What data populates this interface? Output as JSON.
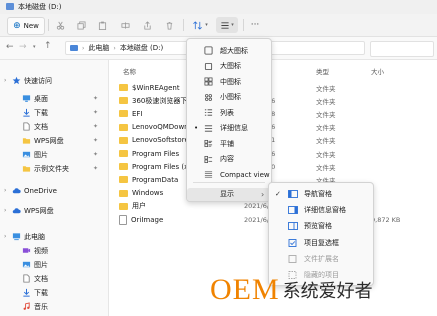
{
  "window": {
    "title": "本地磁盘 (D:)"
  },
  "toolbar": {
    "new_label": "New"
  },
  "address": {
    "path": [
      "此电脑",
      "本地磁盘 (D:)"
    ]
  },
  "nav": {
    "items": [
      {
        "label": "快速访问",
        "pinned": false,
        "icon": "star-icon",
        "color": "#2b6fd6"
      },
      {
        "label": "桌面",
        "pinned": true,
        "icon": "desktop-icon",
        "color": "#3a8fe0"
      },
      {
        "label": "下载",
        "pinned": true,
        "icon": "download-icon",
        "color": "#2b6fd6"
      },
      {
        "label": "文档",
        "pinned": true,
        "icon": "document-icon",
        "color": "#7a7a7a"
      },
      {
        "label": "WPS网盘",
        "pinned": true,
        "icon": "folder-icon",
        "color": "#f5c542"
      },
      {
        "label": "图片",
        "pinned": true,
        "icon": "picture-icon",
        "color": "#3a8fe0"
      },
      {
        "label": "示例文件夹",
        "pinned": true,
        "icon": "folder-icon",
        "color": "#f5c542"
      },
      {
        "label": "OneDrive",
        "pinned": false,
        "icon": "cloud-icon",
        "color": "#2b6fd6"
      },
      {
        "label": "WPS网盘",
        "pinned": false,
        "icon": "cloud-icon",
        "color": "#2b6fd6"
      },
      {
        "label": "此电脑",
        "pinned": false,
        "icon": "computer-icon",
        "color": "#3a8fe0"
      },
      {
        "label": "视频",
        "pinned": false,
        "icon": "video-icon",
        "color": "#8a4fd8"
      },
      {
        "label": "图片",
        "pinned": false,
        "icon": "picture-icon",
        "color": "#3a8fe0"
      },
      {
        "label": "文档",
        "pinned": false,
        "icon": "document-icon",
        "color": "#7a7a7a"
      },
      {
        "label": "下载",
        "pinned": false,
        "icon": "download-icon",
        "color": "#2b6fd6"
      },
      {
        "label": "音乐",
        "pinned": false,
        "icon": "music-icon",
        "color": "#e04a3a"
      }
    ]
  },
  "files": {
    "headers": {
      "name": "名称",
      "type": "类型",
      "size": "大小"
    },
    "rows": [
      {
        "name": "$WinREAgent",
        "date": "2:15",
        "type": "文件夹",
        "size": ""
      },
      {
        "name": "360极速浏览器下载",
        "date": "5/3 17:26",
        "type": "文件夹",
        "size": ""
      },
      {
        "name": "EFI",
        "date": "5/6 17:18",
        "type": "文件夹",
        "size": ""
      },
      {
        "name": "LenovoQMDownload",
        "date": "5/3 12:06",
        "type": "文件夹",
        "size": ""
      },
      {
        "name": "LenovoSoftstore",
        "date": "5/3 23:31",
        "type": "文件夹",
        "size": ""
      },
      {
        "name": "Program Files",
        "date": "5/6 17:26",
        "type": "文件夹",
        "size": ""
      },
      {
        "name": "Program Files (x86)",
        "date": "5/6 15:00",
        "type": "文件夹",
        "size": ""
      },
      {
        "name": "ProgramData",
        "date": "",
        "type": "文件夹",
        "size": ""
      },
      {
        "name": "Windows",
        "date": "2021/4/",
        "type": "文件夹",
        "size": ""
      },
      {
        "name": "用户",
        "date": "2021/6/",
        "type": "文件夹",
        "size": ""
      },
      {
        "name": "OriImage",
        "date": "2021/6/2",
        "type": "文件",
        "size": "9,872 KB"
      }
    ]
  },
  "view_menu": {
    "items": [
      {
        "label": "超大图标",
        "icon": "extra-large-icons-icon"
      },
      {
        "label": "大图标",
        "icon": "large-icons-icon"
      },
      {
        "label": "中图标",
        "icon": "medium-icons-icon"
      },
      {
        "label": "小图标",
        "icon": "small-icons-icon"
      },
      {
        "label": "列表",
        "icon": "list-view-icon"
      },
      {
        "label": "详细信息",
        "icon": "details-view-icon",
        "bullet": "•"
      },
      {
        "label": "平铺",
        "icon": "tiles-view-icon"
      },
      {
        "label": "内容",
        "icon": "content-view-icon"
      },
      {
        "label": "Compact view",
        "icon": "compact-view-icon"
      },
      {
        "label": "显示",
        "icon": "",
        "submenu": "›"
      }
    ]
  },
  "show_menu": {
    "items": [
      {
        "label": "导航窗格",
        "checked": "✓",
        "icon": "navigation-pane-icon"
      },
      {
        "label": "详细信息窗格",
        "checked": "",
        "icon": "details-pane-icon"
      },
      {
        "label": "预览窗格",
        "checked": "",
        "icon": "preview-pane-icon"
      },
      {
        "label": "项目复选框",
        "checked": "",
        "icon": "item-checkbox-icon"
      },
      {
        "label": "文件扩展名",
        "checked": "",
        "icon": "file-extension-icon"
      },
      {
        "label": "隐藏的项目",
        "checked": "",
        "icon": "hidden-items-icon"
      }
    ]
  },
  "watermark": {
    "brand": "OEM",
    "text": "系统爱好者"
  },
  "colors": {
    "accent": "#0067c0",
    "folder": "#f5c542",
    "brand_orange": "#f08300"
  }
}
